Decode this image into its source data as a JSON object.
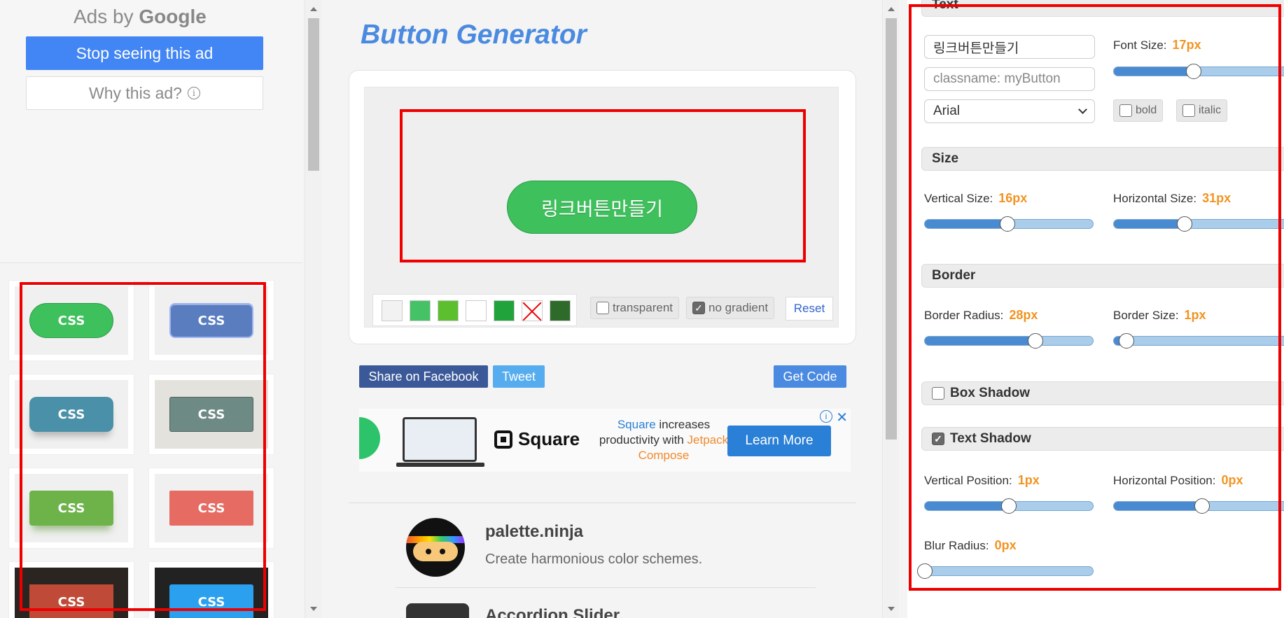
{
  "ad_panel": {
    "ads_by": "Ads by",
    "google": "Google",
    "stop_label": "Stop seeing this ad",
    "why_label": "Why this ad?",
    "info_glyph": "i"
  },
  "gallery": {
    "button_label": "CSS",
    "items": [
      {
        "color": "#3ec05c",
        "bg": "#f0f0f0"
      },
      {
        "color": "#5a7dc0",
        "bg": "#f0f0f0"
      },
      {
        "color": "#4a90a8",
        "bg": "#f0f0f0"
      },
      {
        "color": "#6e8a84",
        "bg": "#e4e2dc"
      },
      {
        "color": "#6db34a",
        "bg": "#f0f0f0"
      },
      {
        "color": "#e66b62",
        "bg": "#f0f0f0"
      },
      {
        "color": "#c04a38",
        "bg": "#2a2520"
      },
      {
        "color": "#2aa0ee",
        "bg": "#222"
      }
    ]
  },
  "main": {
    "title": "Button Generator",
    "preview_button_text": "링크버튼만들기",
    "swatches": [
      "#f2f2f2",
      "#46c266",
      "#5cc02e",
      "#ffffff",
      "#1fa33a",
      "none",
      "#2e6a2a"
    ],
    "transparent_label": "transparent",
    "no_gradient_label": "no gradient",
    "reset_label": "Reset",
    "share_facebook": "Share on Facebook",
    "tweet": "Tweet",
    "get_code": "Get Code"
  },
  "ad_banner": {
    "brand": "Square",
    "tagline_brand": "Square",
    "tagline_mid": " increases productivity with ",
    "tagline_end": "Jetpack Compose",
    "cta": "Learn More",
    "close": "✕",
    "info": "i"
  },
  "promos": [
    {
      "title": "palette.ninja",
      "desc": "Create harmonious color schemes."
    },
    {
      "title": "Accordion Slider",
      "desc": ""
    }
  ],
  "settings": {
    "text_section": "Text",
    "text_value": "링크버튼만들기",
    "classname_placeholder": "classname: myButton",
    "font_family": "Arial",
    "font_size_label": "Font Size:",
    "font_size_value": "17px",
    "font_size_level": 0.44,
    "bold_label": "bold",
    "italic_label": "italic",
    "size_section": "Size",
    "vertical_size_label": "Vertical Size:",
    "vertical_size_value": "16px",
    "vertical_size_level": 0.49,
    "horizontal_size_label": "Horizontal Size:",
    "horizontal_size_value": "31px",
    "horizontal_size_level": 0.39,
    "border_section": "Border",
    "border_radius_label": "Border Radius:",
    "border_radius_value": "28px",
    "border_radius_level": 0.66,
    "border_size_label": "Border Size:",
    "border_size_value": "1px",
    "border_size_level": 0.07,
    "box_shadow_label": "Box Shadow",
    "box_shadow_checked": false,
    "text_shadow_label": "Text Shadow",
    "text_shadow_checked": true,
    "vertical_position_label": "Vertical Position:",
    "vertical_position_value": "1px",
    "vertical_position_level": 0.5,
    "horizontal_position_label": "Horizontal Position:",
    "horizontal_position_value": "0px",
    "horizontal_position_level": 0.49,
    "blur_radius_label": "Blur Radius:",
    "blur_radius_value": "0px",
    "blur_radius_level": 0.0
  }
}
